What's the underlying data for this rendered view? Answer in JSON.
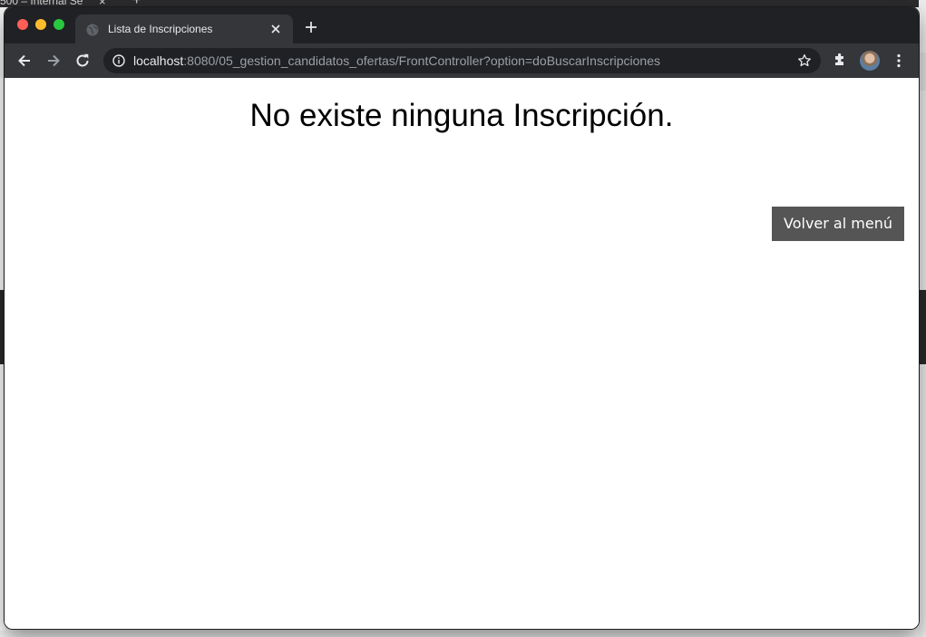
{
  "background_window": {
    "tab_title": "500 – Internal Se",
    "tab_close": "×",
    "new_tab": "+"
  },
  "browser": {
    "tab": {
      "title": "Lista de Inscripciones"
    },
    "address_bar": {
      "host": "localhost",
      "path": ":8080/05_gestion_candidatos_ofertas/FrontController?option=doBuscarInscripciones"
    },
    "icons": [
      "back-icon",
      "forward-icon",
      "reload-icon",
      "info-icon",
      "star-icon",
      "extensions-icon",
      "avatar",
      "menu-icon"
    ],
    "colors": {
      "titlebar": "#202124",
      "toolbar": "#35363a",
      "close": "#ff5f57",
      "minimize": "#febc2e",
      "maximize": "#28c840"
    }
  },
  "page": {
    "heading": "No existe ninguna Inscripción.",
    "back_button_label": "Volver al menú",
    "colors": {
      "button_bg": "#555555",
      "button_text": "#ffffff"
    }
  }
}
